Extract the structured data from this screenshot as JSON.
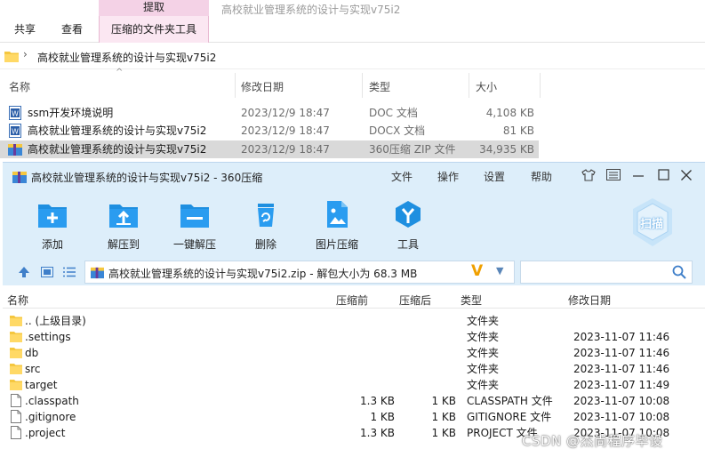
{
  "ribbon": {
    "context_header": "提取",
    "tabs": [
      "共享",
      "查看"
    ],
    "context_tab": "压缩的文件夹工具",
    "window_title": "高校就业管理系统的设计与实现v75i2"
  },
  "address": {
    "separator": "›",
    "path": "高校就业管理系统的设计与实现v75i2"
  },
  "explorer": {
    "columns": [
      "名称",
      "修改日期",
      "类型",
      "大小"
    ],
    "sort_indicator": "^",
    "files": [
      {
        "name": "ssm开发环境说明",
        "date": "2023/12/9 18:47",
        "type": "DOC 文档",
        "size": "4,108 KB",
        "icon": "word-doc-icon"
      },
      {
        "name": "高校就业管理系统的设计与实现v75i2",
        "date": "2023/12/9 18:47",
        "type": "DOCX 文档",
        "size": "81 KB",
        "icon": "word-doc-icon"
      },
      {
        "name": "高校就业管理系统的设计与实现v75i2",
        "date": "2023/12/9 18:47",
        "type": "360压缩 ZIP 文件",
        "size": "34,935 KB",
        "icon": "zip-archive-icon",
        "selected": true
      }
    ]
  },
  "zip_window": {
    "title": "高校就业管理系统的设计与实现v75i2 - 360压缩",
    "menu": [
      "文件",
      "操作",
      "设置",
      "帮助"
    ],
    "window_controls": [
      "shirt-icon",
      "menu-icon",
      "minimize-icon",
      "maximize-icon",
      "close-icon"
    ],
    "toolbar": [
      {
        "label": "添加",
        "icon": "add-icon"
      },
      {
        "label": "解压到",
        "icon": "extract-to-icon"
      },
      {
        "label": "一键解压",
        "icon": "one-click-extract-icon"
      },
      {
        "label": "删除",
        "icon": "delete-icon"
      },
      {
        "label": "图片压缩",
        "icon": "image-compress-icon"
      },
      {
        "label": "工具",
        "icon": "tools-icon"
      }
    ],
    "scan_label": "扫描",
    "path_text": "高校就业管理系统的设计与实现v75i2.zip - 解包大小为 68.3 MB",
    "path_badge": "V",
    "path_dropdown": "▼",
    "columns": [
      "名称",
      "压缩前",
      "压缩后",
      "类型",
      "修改日期"
    ],
    "entries": [
      {
        "name": ".. (上级目录)",
        "before": "",
        "after": "",
        "type": "文件夹",
        "date": "",
        "icon": "folder-icon"
      },
      {
        "name": ".settings",
        "before": "",
        "after": "",
        "type": "文件夹",
        "date": "2023-11-07 11:46",
        "icon": "folder-icon"
      },
      {
        "name": "db",
        "before": "",
        "after": "",
        "type": "文件夹",
        "date": "2023-11-07 11:46",
        "icon": "folder-icon"
      },
      {
        "name": "src",
        "before": "",
        "after": "",
        "type": "文件夹",
        "date": "2023-11-07 11:46",
        "icon": "folder-icon"
      },
      {
        "name": "target",
        "before": "",
        "after": "",
        "type": "文件夹",
        "date": "2023-11-07 11:49",
        "icon": "folder-icon"
      },
      {
        "name": ".classpath",
        "before": "1.3 KB",
        "after": "1 KB",
        "type": "CLASSPATH 文件",
        "date": "2023-11-07 10:08",
        "icon": "file-icon"
      },
      {
        "name": ".gitignore",
        "before": "1 KB",
        "after": "1 KB",
        "type": "GITIGNORE 文件",
        "date": "2023-11-07 10:08",
        "icon": "file-icon"
      },
      {
        "name": ".project",
        "before": "1.3 KB",
        "after": "1 KB",
        "type": "PROJECT 文件",
        "date": "2023-11-07 10:08",
        "icon": "file-icon"
      }
    ]
  },
  "watermark": "CSDN @杰尚程序毕设",
  "colors": {
    "context_tab": "#fbe7f2",
    "zip_chrome": "#ddeefa",
    "icon_blue": "#1e8fe0",
    "folder_yellow": "#f5c73f",
    "selected_row": "#d9d9d9"
  }
}
